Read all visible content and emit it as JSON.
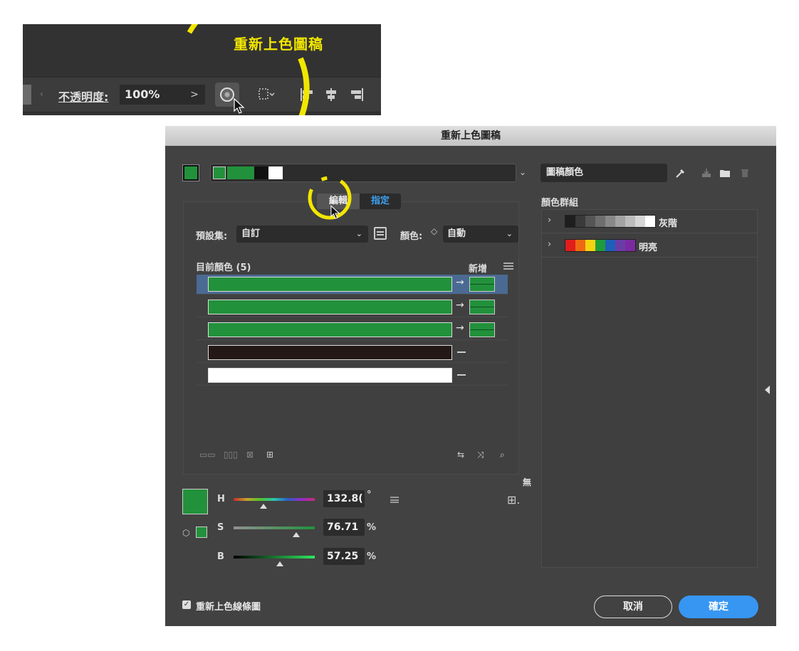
{
  "toolbar": {
    "callout": "重新上色圖稿",
    "opacity_label": "不透明度:",
    "opacity_value": "100%",
    "opacity_arrow": ">",
    "recolor_icon": "color-wheel-icon",
    "select_icon": "selection-dropdown-icon",
    "align_icons": [
      "align-left-icon",
      "align-center-icon",
      "align-right-icon"
    ],
    "highlight_color": "#f2e600"
  },
  "dialog": {
    "title": "重新上色圖稿",
    "artwork_colors_field": "圖稿顏色",
    "right_icons": [
      "eyedropper-icon",
      "save-group-icon",
      "folder-icon",
      "trash-icon"
    ],
    "tabs": [
      {
        "label": "編輯",
        "active": true
      },
      {
        "label": "指定",
        "active": false
      }
    ],
    "preset_label": "預設集:",
    "preset_value": "自訂",
    "colors_label": "顏色:",
    "colors_stepper": "⌃",
    "colors_value": "自動",
    "current_colors_label": "目前顏色 (5)",
    "new_label": "新增",
    "rows": [
      {
        "color": "#22913b",
        "mapped": true,
        "selected": true
      },
      {
        "color": "#22913b",
        "mapped": true,
        "selected": false
      },
      {
        "color": "#22913b",
        "mapped": true,
        "selected": false
      },
      {
        "color": "#231815",
        "mapped": false,
        "selected": false
      },
      {
        "color": "#ffffff",
        "mapped": false,
        "selected": false
      }
    ],
    "hsb": {
      "h_label": "H",
      "h_value": "132.8(",
      "h_unit": "°",
      "s_label": "S",
      "s_value": "76.71",
      "s_unit": "%",
      "b_label": "B",
      "b_value": "57.25",
      "b_unit": "%",
      "h_fraction": 0.37,
      "s_fraction": 0.77,
      "b_fraction": 0.57
    },
    "none_label": "無",
    "color_groups_label": "顏色群組",
    "color_groups": [
      {
        "name": "灰階",
        "swatches": [
          "#1e1e1e",
          "#3a3a3a",
          "#555555",
          "#6e6e6e",
          "#888888",
          "#a3a3a3",
          "#bcbcbc",
          "#d6d6d6",
          "#ffffff"
        ]
      },
      {
        "name": "明亮",
        "swatches": [
          "#e11d1d",
          "#ee6a12",
          "#f5d312",
          "#1f9c3a",
          "#1f5fb8",
          "#6a3ca8",
          "#7a2aa0"
        ]
      }
    ],
    "recolor_lines_checkbox": "重新上色線條圖",
    "cancel_label": "取消",
    "ok_label": "確定",
    "swatch_strip": [
      "#22913b",
      "#22913b",
      "#22913b",
      "#231815",
      "#ffffff"
    ],
    "main_color": "#22913b",
    "accent": "#3796f2"
  }
}
